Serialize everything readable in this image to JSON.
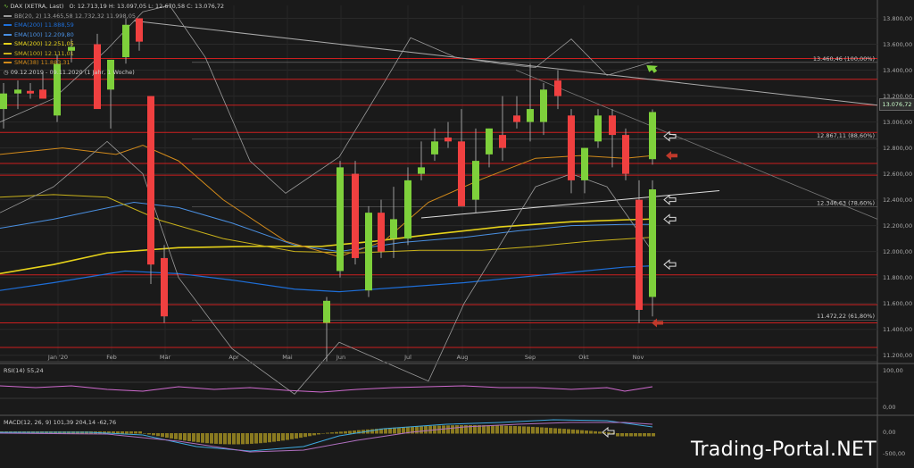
{
  "header": {
    "symbol_text": "DAX (XETRA, Last)",
    "ohlc_text": "O: 12.713,19  H: 13.097,05  L: 12.670,58  C: 13.076,72"
  },
  "legend": [
    {
      "label": "BB(20, 2)",
      "values": "13.465,58  12.732,32  11.998,05",
      "color": "#9a9a9a"
    },
    {
      "label": "EMA(200)",
      "values": "11.888,59",
      "color": "#1e6fd9"
    },
    {
      "label": "EMA(100)",
      "values": "12.209,80",
      "color": "#4a90e2"
    },
    {
      "label": "SMA(200)",
      "values": "12.251,05",
      "color": "#e6d21a"
    },
    {
      "label": "SMA(100)",
      "values": "12.111,01",
      "color": "#c9b21a"
    },
    {
      "label": "SMA(38)",
      "values": "11.883,31",
      "color": "#d28a1a"
    }
  ],
  "period_text": "09.12.2019 - 09.11.2020  (1 Jahr, 1 Woche)",
  "last_price": "13.076,72",
  "rsi_label": "RSI(14)  55,24",
  "macd_label": "MACD(12, 26, 9)  101,39  204,14  -62,76",
  "watermark": "Trading-Portal.NET",
  "colors": {
    "bull": "#7ed03b",
    "bear": "#f04040",
    "bg": "#1a1a1a",
    "grid": "#333333",
    "resistance": "#cc1f1f"
  },
  "chart_data": {
    "type": "candlestick",
    "title": "DAX (XETRA, Last)",
    "y_ticks": [
      "13.800,00",
      "13.600,00",
      "13.400,00",
      "13.200,00",
      "13.000,00",
      "12.800,00",
      "12.600,00",
      "12.400,00",
      "12.200,00",
      "12.000,00",
      "11.800,00",
      "11.600,00",
      "11.400,00",
      "11.200,00"
    ],
    "ylim": [
      11150,
      13900
    ],
    "x_labels": [
      "Jan '20",
      "Feb",
      "Mär",
      "Apr",
      "Mai",
      "Jun",
      "Jul",
      "Aug",
      "Sep",
      "Okt",
      "Nov"
    ],
    "fib_labels": [
      "13.460,46 (100,00%)",
      "12.867,11 (88,60%)",
      "12.346,63 (78,60%)",
      "11.472,22 (61,80%)"
    ],
    "fib_values": [
      13460.46,
      12867.11,
      12346.63,
      11472.22
    ],
    "red_lines": [
      13490,
      13330,
      13130,
      12920,
      12680,
      12590,
      11820,
      11590,
      11450,
      11260
    ],
    "candles": [
      {
        "x": "Dez 20",
        "o": 13100,
        "h": 13300,
        "l": 12950,
        "c": 13220
      },
      {
        "x": "Dez 27",
        "o": 13220,
        "h": 13320,
        "l": 13100,
        "c": 13250
      },
      {
        "x": "Jan 03",
        "o": 13240,
        "h": 13300,
        "l": 13180,
        "c": 13220
      },
      {
        "x": "Jan 10",
        "o": 13250,
        "h": 13380,
        "l": 13180,
        "c": 13180
      },
      {
        "x": "Jan 17",
        "o": 13050,
        "h": 13520,
        "l": 13000,
        "c": 13450
      },
      {
        "x": "Jan 24",
        "o": 13550,
        "h": 13640,
        "l": 13460,
        "c": 13580
      },
      {
        "x": "Jan 31",
        "o": 13600,
        "h": 13680,
        "l": 13430,
        "c": 13100
      },
      {
        "x": "Feb 07",
        "o": 13250,
        "h": 13480,
        "l": 12950,
        "c": 13480
      },
      {
        "x": "Feb 14",
        "o": 13500,
        "h": 13800,
        "l": 13450,
        "c": 13750
      },
      {
        "x": "Feb 21",
        "o": 13800,
        "h": 13800,
        "l": 13550,
        "c": 13620
      },
      {
        "x": "Feb 28",
        "o": 13200,
        "h": 13200,
        "l": 11750,
        "c": 11900
      },
      {
        "x": "Mär 06",
        "o": 11950,
        "h": 12050,
        "l": 11450,
        "c": 11500
      },
      {
        "x": "Jun 01",
        "o": 11450,
        "h": 11650,
        "l": 11150,
        "c": 11620
      },
      {
        "x": "Jun 08",
        "o": 11850,
        "h": 12700,
        "l": 11800,
        "c": 12650
      },
      {
        "x": "Jun 15",
        "o": 12600,
        "h": 12700,
        "l": 11900,
        "c": 11950
      },
      {
        "x": "Jun 22",
        "o": 11700,
        "h": 12350,
        "l": 11650,
        "c": 12300
      },
      {
        "x": "Jun 29",
        "o": 12300,
        "h": 12400,
        "l": 11950,
        "c": 12000
      },
      {
        "x": "Jul 06",
        "o": 12100,
        "h": 12500,
        "l": 11950,
        "c": 12250
      },
      {
        "x": "Jul 13",
        "o": 12100,
        "h": 12650,
        "l": 12050,
        "c": 12550
      },
      {
        "x": "Jul 20",
        "o": 12600,
        "h": 12850,
        "l": 12550,
        "c": 12650
      },
      {
        "x": "Jul 27",
        "o": 12750,
        "h": 12950,
        "l": 12700,
        "c": 12850
      },
      {
        "x": "Aug 03",
        "o": 12880,
        "h": 13000,
        "l": 12800,
        "c": 12850
      },
      {
        "x": "Aug 10",
        "o": 12850,
        "h": 13100,
        "l": 12450,
        "c": 12350
      },
      {
        "x": "Aug 17",
        "o": 12400,
        "h": 12950,
        "l": 12300,
        "c": 12700
      },
      {
        "x": "Aug 24",
        "o": 12750,
        "h": 12950,
        "l": 12650,
        "c": 12950
      },
      {
        "x": "Aug 31",
        "o": 12900,
        "h": 13200,
        "l": 12700,
        "c": 12800
      },
      {
        "x": "Sep 07",
        "o": 13050,
        "h": 13200,
        "l": 12950,
        "c": 13000
      },
      {
        "x": "Sep 14",
        "o": 13000,
        "h": 13450,
        "l": 12850,
        "c": 13100
      },
      {
        "x": "Sep 21",
        "o": 13000,
        "h": 13300,
        "l": 12900,
        "c": 13250
      },
      {
        "x": "Sep 28",
        "o": 13320,
        "h": 13400,
        "l": 13100,
        "c": 13200
      },
      {
        "x": "Okt 05",
        "o": 13050,
        "h": 13100,
        "l": 12450,
        "c": 12550
      },
      {
        "x": "Okt 12",
        "o": 12550,
        "h": 12800,
        "l": 12450,
        "c": 12800
      },
      {
        "x": "Okt 19",
        "o": 12850,
        "h": 13100,
        "l": 12800,
        "c": 13050
      },
      {
        "x": "Okt 26",
        "o": 13050,
        "h": 13100,
        "l": 12650,
        "c": 12900
      },
      {
        "x": "Okt 30",
        "o": 12900,
        "h": 12950,
        "l": 12550,
        "c": 12600
      },
      {
        "x": "Nov 02",
        "o": 12400,
        "h": 12550,
        "l": 11450,
        "c": 11550
      },
      {
        "x": "Nov 06",
        "o": 11650,
        "h": 12550,
        "l": 11500,
        "c": 12480
      },
      {
        "x": "Nov 09",
        "o": 12713.19,
        "h": 13097.05,
        "l": 12670.58,
        "c": 13076.72
      }
    ],
    "rsi_ticks": [
      "100,00",
      "0,00"
    ],
    "macd_ticks": [
      "0,00",
      "-500,00"
    ]
  }
}
